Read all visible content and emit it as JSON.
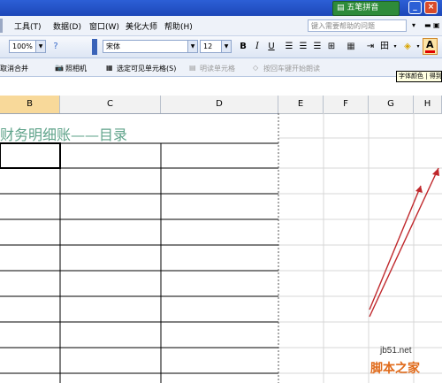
{
  "ime": {
    "label": "五笔拼音"
  },
  "menu": {
    "items": [
      "工具(T)",
      "数据(D)",
      "窗口(W)",
      "美化大师",
      "帮助(H)"
    ]
  },
  "help_box": {
    "placeholder": "键入需要帮助的问题"
  },
  "toolbar": {
    "zoom": "100%",
    "font_name": "宋体",
    "font_size": "12",
    "bold": "B",
    "italic": "I",
    "underline": "U",
    "font_color_label": "A"
  },
  "toolbar2": {
    "cancel_merge": "取消合并",
    "camera": "照相机",
    "select_visible": "选定可见单元格(S)",
    "bright_cells": "明读单元格",
    "read_aloud": "按回车键开始朗读"
  },
  "tooltip": {
    "text": "字体颜色 | 得到"
  },
  "columns": [
    "B",
    "C",
    "D",
    "E",
    "F",
    "G",
    "H"
  ],
  "sheet": {
    "title": "财务明细账——目录"
  },
  "watermark": {
    "site": "jb51.net",
    "brand": "脚本之家"
  },
  "colors": {
    "title_text": "#5fa38a",
    "arrow": "#c0282c",
    "header_bg": "#f2f2f2"
  }
}
